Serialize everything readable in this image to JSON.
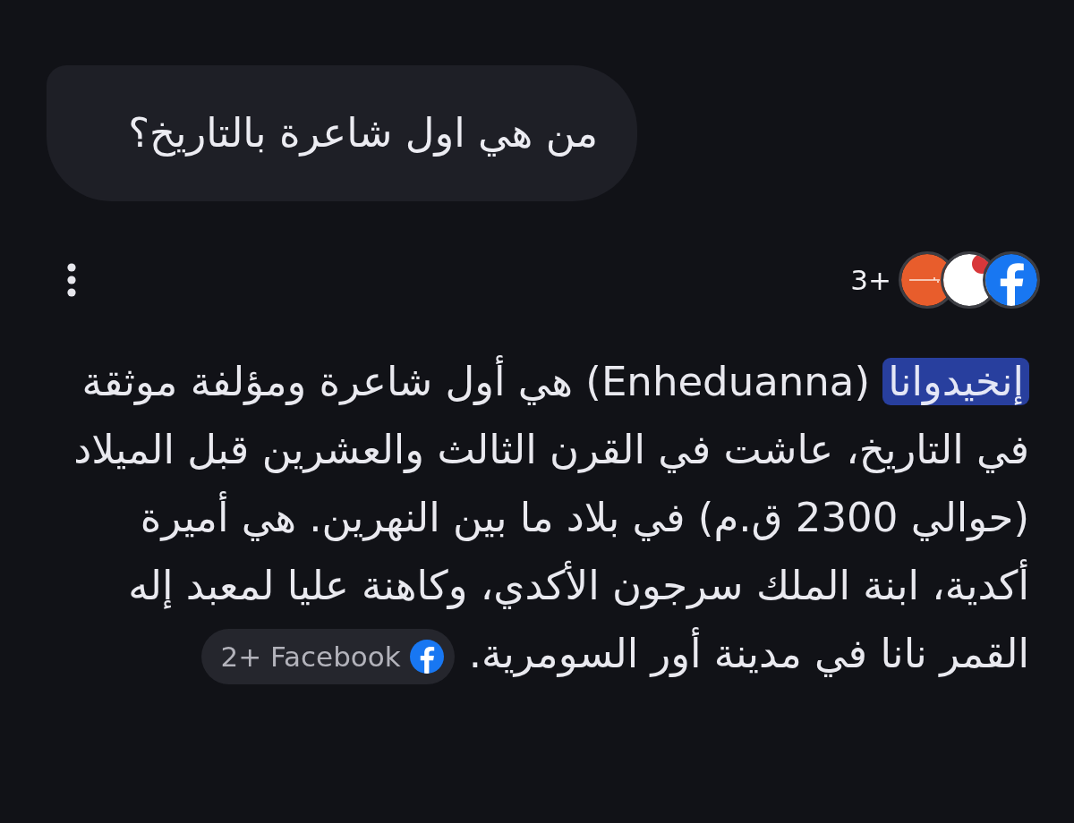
{
  "user_message": {
    "text": "من هي اول شاعرة بالتاريخ؟"
  },
  "response_header": {
    "sources_count": "3+",
    "source_icons": [
      {
        "kind": "line"
      },
      {
        "kind": "dot"
      },
      {
        "kind": "facebook"
      }
    ]
  },
  "answer": {
    "segments": [
      {
        "kind": "highlight",
        "text": "إنخيدوانا"
      },
      {
        "kind": "plain",
        "text": " (Enheduanna) هي أول شاعرة ومؤلفة موثقة في التاريخ، عاشت في القرن الثالث والعشرين قبل الميلاد (حوالي 2300 ق.م) في بلاد ما بين النهرين. هي أميرة أكدية، ابنة الملك سرجون الأكدي، وكاهنة عليا لمعبد إله القمر نانا في مدينة أور السومرية."
      }
    ],
    "source_chip": {
      "label": "2+ Facebook",
      "kind": "facebook"
    }
  }
}
